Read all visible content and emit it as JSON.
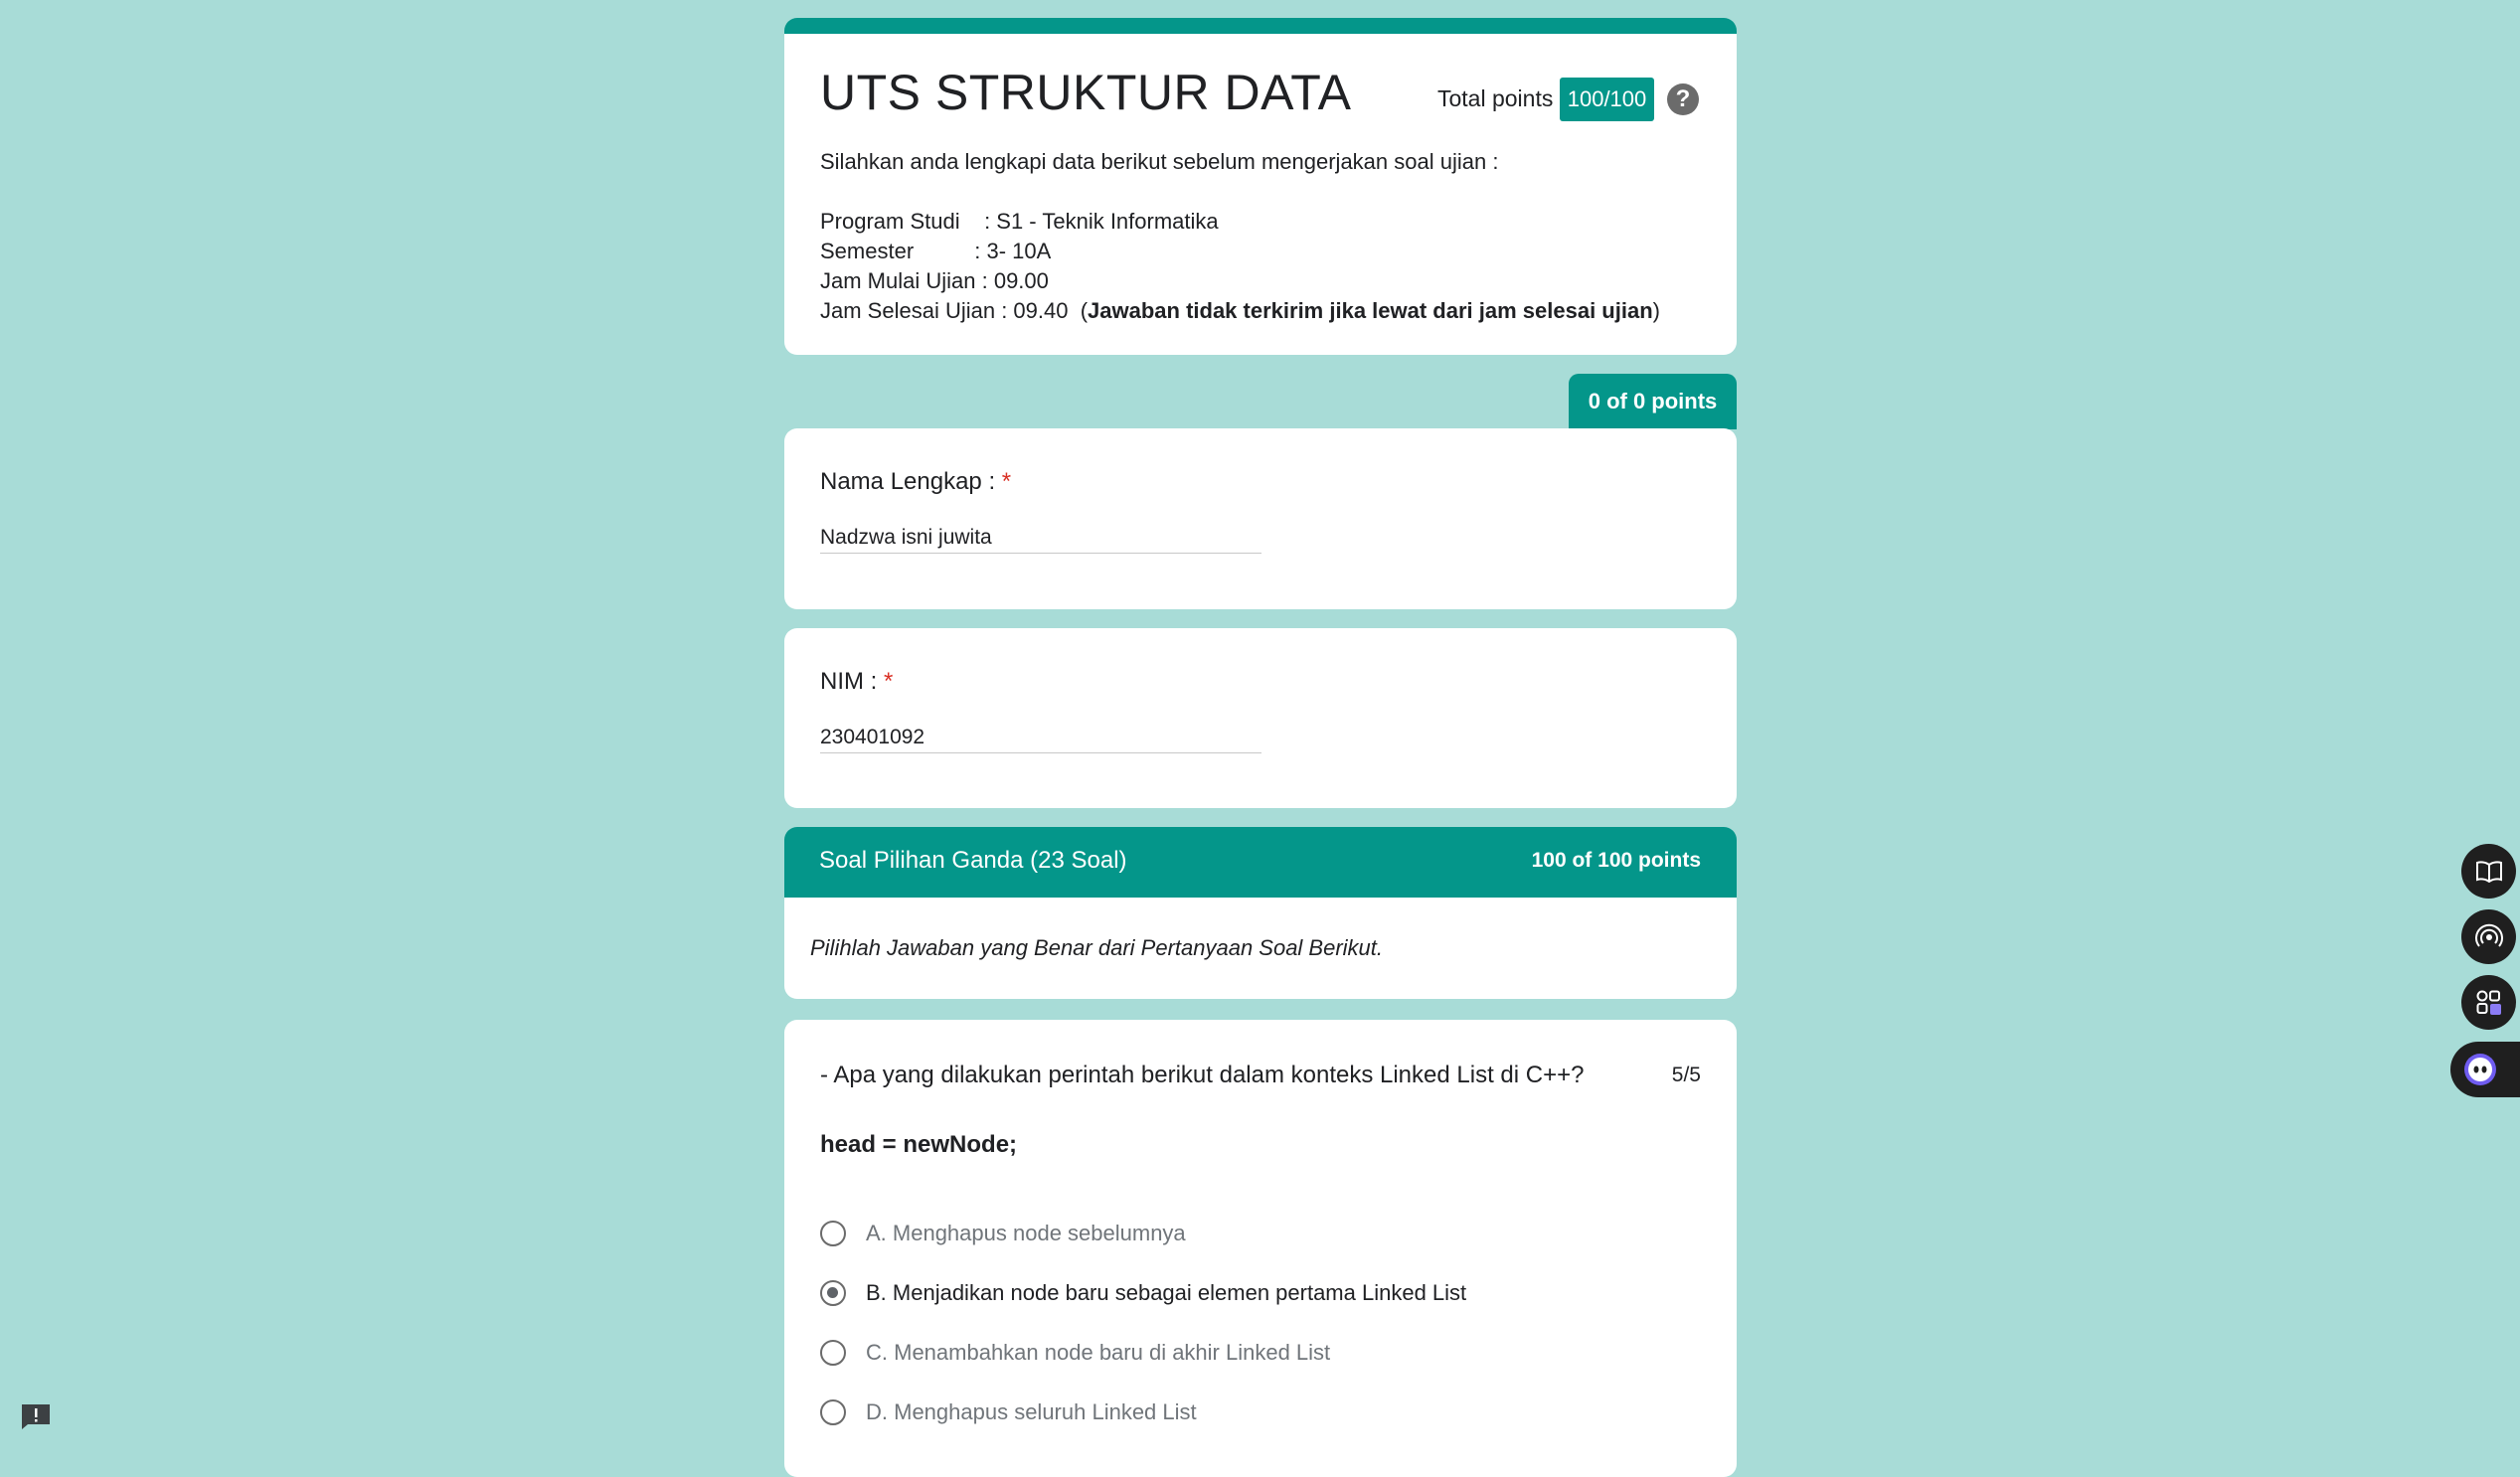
{
  "header": {
    "title": "UTS STRUKTUR DATA",
    "total_points_label": "Total points",
    "total_points_value": "100/100",
    "help_symbol": "?",
    "intro": "Silahkan anda lengkapi data berikut sebelum mengerjakan soal ujian :",
    "program_line": "Program Studi    : S1 - Teknik Informatika",
    "semester_line": "Semester          : 3- 10A",
    "start_line": "Jam Mulai Ujian : 09.00",
    "end_line_prefix": "Jam Selesai Ujian : 09.40  (",
    "end_line_bold": "Jawaban tidak terkirim jika lewat dari jam selesai ujian",
    "end_line_suffix": ")"
  },
  "info_points": "0 of 0 points",
  "name_question": {
    "label": "Nama Lengkap :",
    "required": "*",
    "answer": "Nadzwa isni juwita"
  },
  "nim_question": {
    "label": "NIM :",
    "required": "*",
    "answer": "230401092"
  },
  "section": {
    "title": "Soal Pilihan Ganda (23 Soal)",
    "points": "100 of 100 points",
    "description": "Pilihlah Jawaban yang Benar dari Pertanyaan Soal Berikut."
  },
  "question1": {
    "text": "-  Apa yang dilakukan perintah berikut dalam konteks Linked List di C++?",
    "score": "5/5",
    "code": "head = newNode;",
    "options": [
      {
        "label": "A. Menghapus node sebelumnya",
        "selected": false
      },
      {
        "label": "B. Menjadikan node baru sebagai elemen pertama Linked List",
        "selected": true
      },
      {
        "label": "C. Menambahkan node baru di akhir Linked List",
        "selected": false
      },
      {
        "label": "D. Menghapus seluruh Linked List",
        "selected": false
      }
    ]
  },
  "colors": {
    "background": "#a8dcd7",
    "accent": "#04968a",
    "required": "#d93025"
  },
  "icons": [
    "help-icon",
    "book-icon",
    "broadcast-icon",
    "apps-icon",
    "assistant-icon",
    "feedback-icon"
  ]
}
